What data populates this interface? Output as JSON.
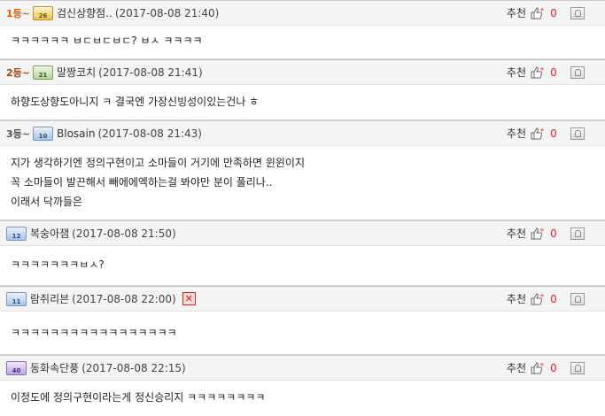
{
  "recommend_label": "추천",
  "comments": [
    {
      "rank": "1등~",
      "level": "26",
      "nick": "검신상향점..",
      "date": "(2017-08-08 21:40)",
      "count": "0",
      "lines": [
        "ㅋㅋㅋㅋㅋㅋ ㅂㄷㅂㄷㅂㄷ? ㅂㅅ ㅋㅋㅋㅋ"
      ]
    },
    {
      "rank": "2등~",
      "level": "21",
      "nick": "말짱코치",
      "date": "(2017-08-08 21:41)",
      "count": "0",
      "lines": [
        "하향도상향도아니지 ㅋ 결국엔 가장신빙성이있는건나 ㅎ"
      ]
    },
    {
      "rank": "3등~",
      "level": "10",
      "nick": "Blosain",
      "date": "(2017-08-08 21:43)",
      "count": "0",
      "lines": [
        "지가 생각하기엔 정의구현이고 소마들이 거기에 만족하면 윈윈이지",
        "꼭 소마들이 발끈해서 빼에에엑하는걸 봐야만 분이 풀리나..",
        "이래서 닥까들은"
      ]
    },
    {
      "rank": "",
      "level": "12",
      "nick": "복숭아잼",
      "date": "(2017-08-08 21:50)",
      "count": "0",
      "lines": [
        "ㅋㅋㅋㅋㅋㅋㅋㅂㅅ?"
      ]
    },
    {
      "rank": "",
      "level": "11",
      "nick": "람쥐리븐",
      "date": "(2017-08-08 22:00)",
      "count": "0",
      "lines": [
        "ㅋㅋㅋㅋㅋㅋㅋㅋㅋㅋㅋㅋㅋㅋㅋㅋㅋ"
      ]
    },
    {
      "rank": "",
      "level": "40",
      "nick": "동화속단풍",
      "date": "(2017-08-08 22:15)",
      "count": "0",
      "lines": [
        "이정도에 정의구현이라는게 정신승리지 ㅋㅋㅋㅋㅋㅋㅋㅋ"
      ]
    }
  ]
}
